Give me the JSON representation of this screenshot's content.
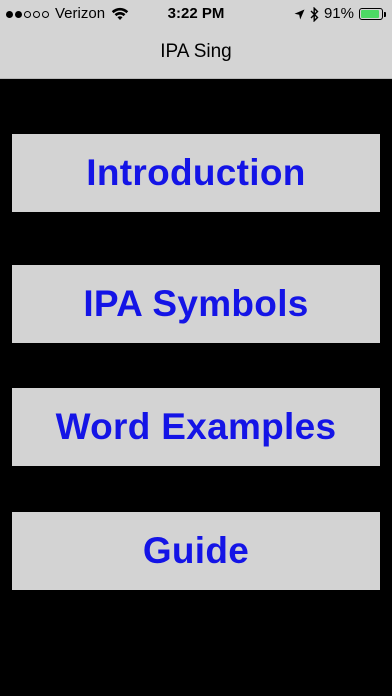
{
  "status_bar": {
    "signal_bars_filled": 2,
    "signal_bars_total": 5,
    "carrier": "Verizon",
    "wifi_icon": "wifi-icon",
    "time": "3:22 PM",
    "location_icon": "location-arrow-icon",
    "bluetooth_icon": "bluetooth-icon",
    "battery_percent": "91%",
    "battery_level": 0.91,
    "battery_color": "#4cd964"
  },
  "navbar": {
    "title": "IPA Sing"
  },
  "menu": {
    "items": [
      {
        "label": "Introduction"
      },
      {
        "label": "IPA Symbols"
      },
      {
        "label": "Word Examples"
      },
      {
        "label": "Guide"
      }
    ],
    "text_color": "#1414e6",
    "button_color": "#d3d3d3"
  }
}
